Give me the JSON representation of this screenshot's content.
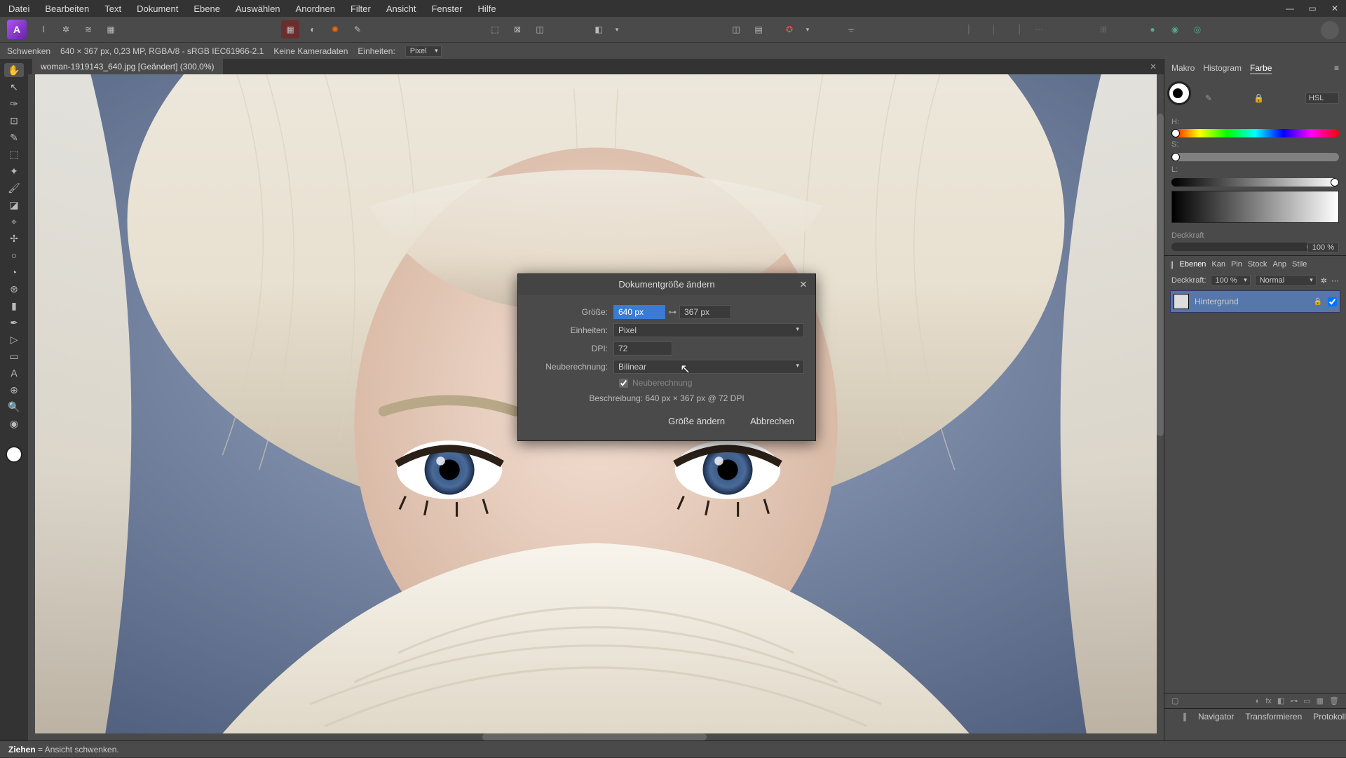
{
  "menu": [
    "Datei",
    "Bearbeiten",
    "Text",
    "Dokument",
    "Ebene",
    "Auswählen",
    "Anordnen",
    "Filter",
    "Ansicht",
    "Fenster",
    "Hilfe"
  ],
  "context": {
    "tool": "Schwenken",
    "info": "640 × 367 px, 0,23 MP, RGBA/8 - sRGB IEC61966-2.1",
    "camera": "Keine Kameradaten",
    "units_label": "Einheiten:",
    "units_value": "Pixel"
  },
  "doc_tab": "woman-1919143_640.jpg [Geändert] (300,0%)",
  "dialog": {
    "title": "Dokumentgröße ändern",
    "size_label": "Größe:",
    "w": "640 px",
    "h": "367 px",
    "units_label": "Einheiten:",
    "units": "Pixel",
    "dpi_label": "DPI:",
    "dpi": "72",
    "resample_label": "Neuberechnung:",
    "resample": "Bilinear",
    "resample_chk": "Neuberechnung",
    "desc_label": "Beschreibung:",
    "desc": "640 px × 367 px @ 72 DPI",
    "ok": "Größe ändern",
    "cancel": "Abbrechen"
  },
  "color_panel": {
    "tabs": [
      "Makro",
      "Histogram",
      "Farbe"
    ],
    "mode": "HSL",
    "h": "0",
    "s": "0",
    "l": "100",
    "opacity_label": "Deckkraft",
    "opacity": "100 %"
  },
  "layers_panel": {
    "tabs": [
      "Ebenen",
      "Kan",
      "Pin",
      "Stock",
      "Anp",
      "Stile"
    ],
    "opacity_label": "Deckkraft:",
    "opacity": "100 %",
    "blend": "Normal",
    "layer_name": "Hintergrund"
  },
  "bottom_tabs": [
    "Navigator",
    "Transformieren",
    "Protokoll"
  ],
  "status_bold": "Ziehen",
  "status_rest": " = Ansicht schwenken."
}
